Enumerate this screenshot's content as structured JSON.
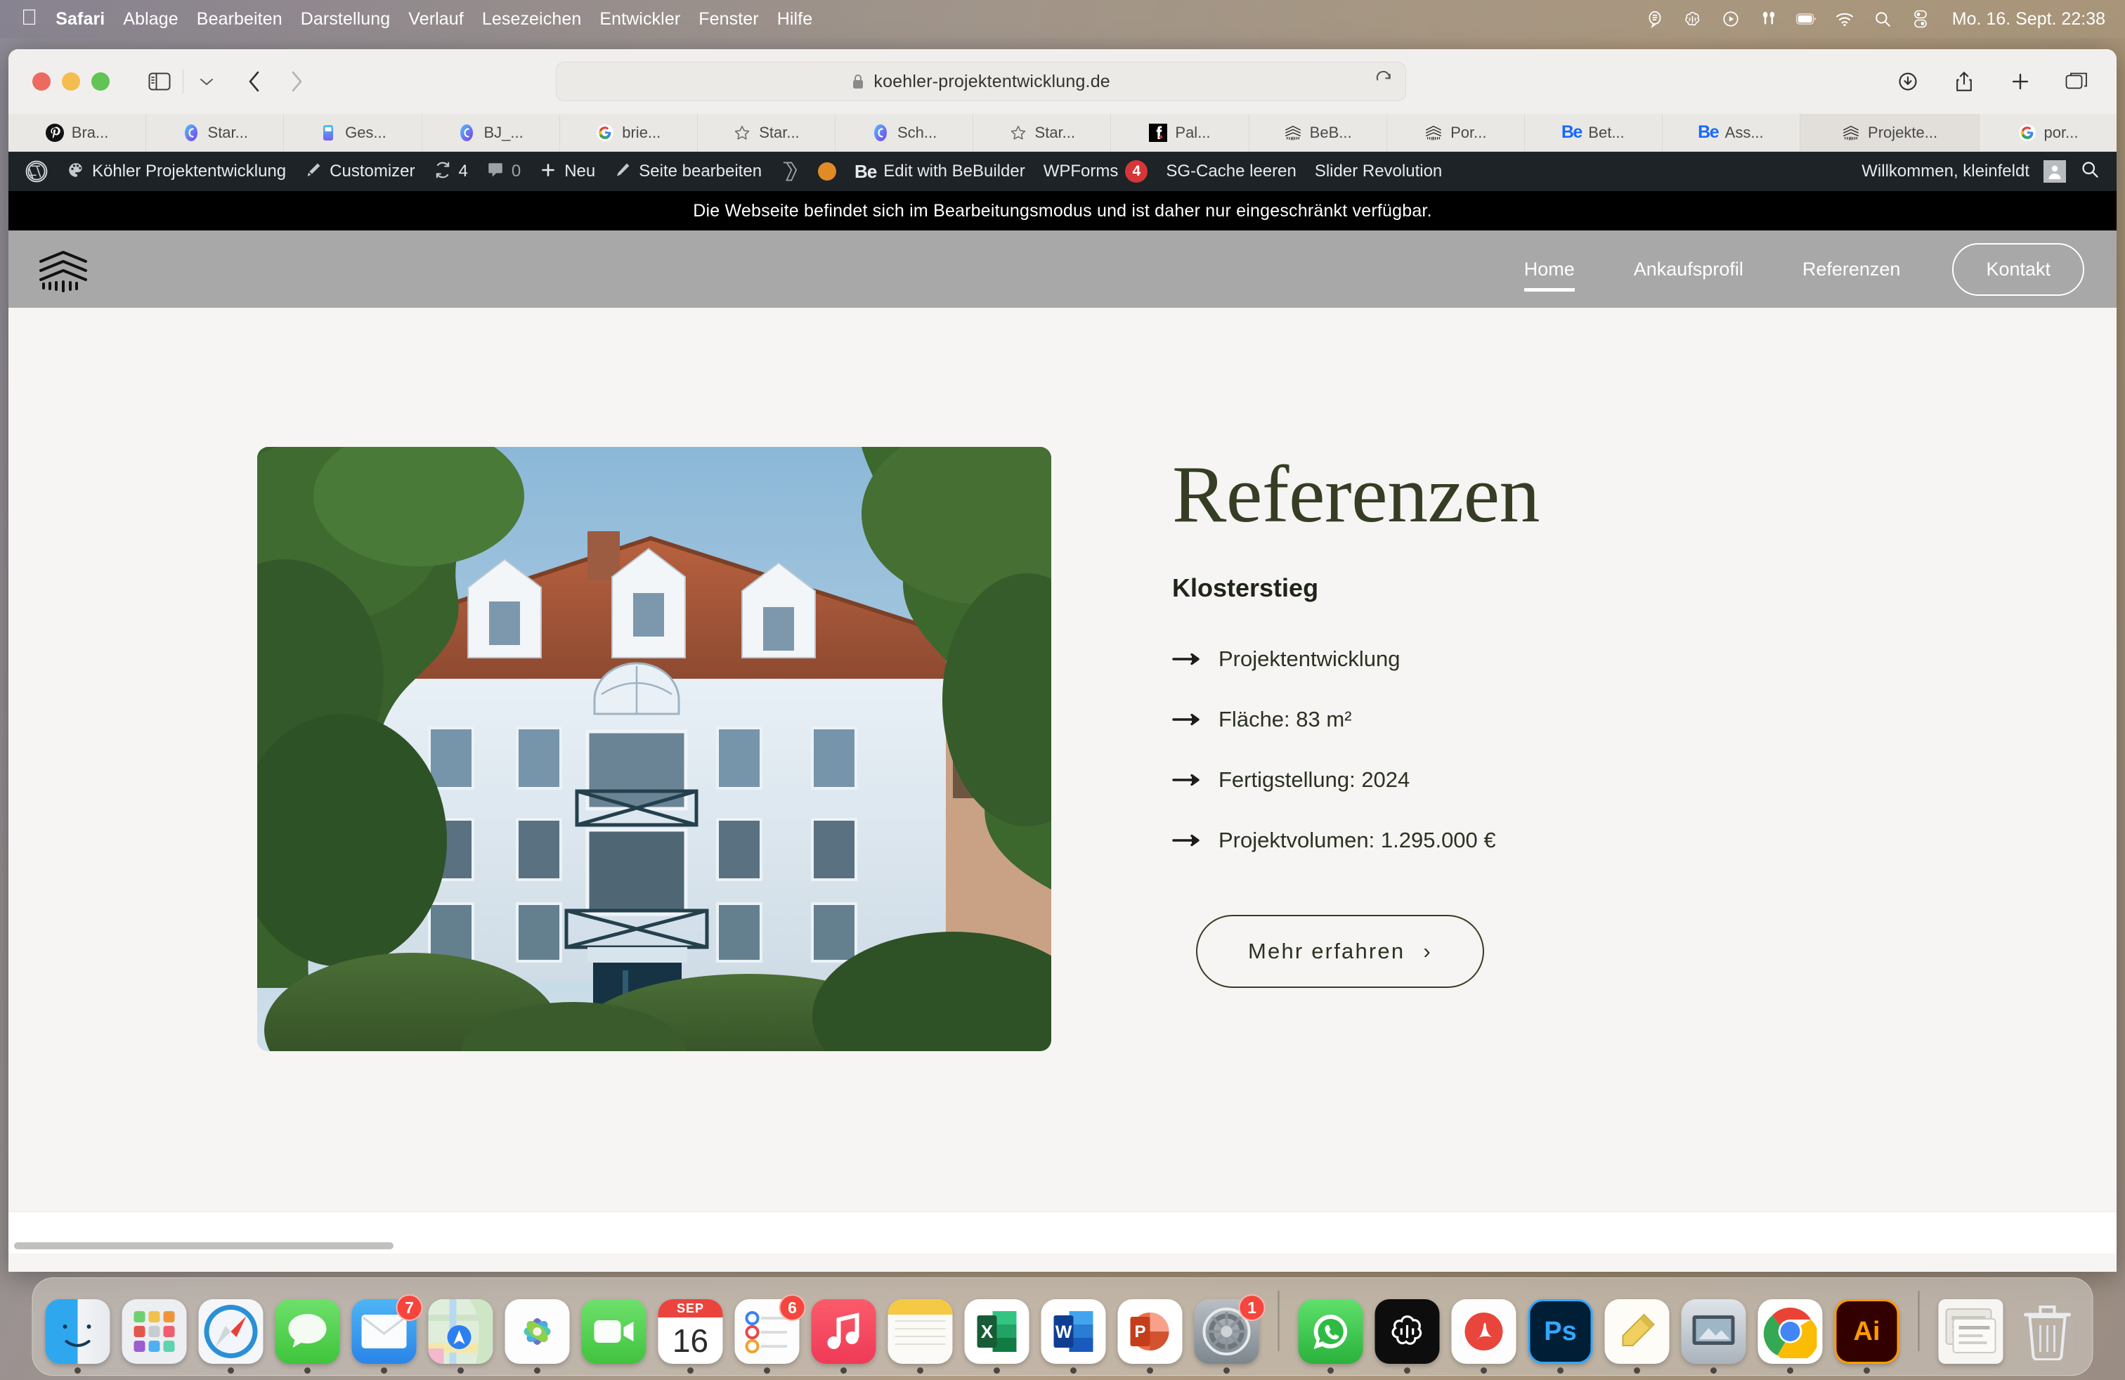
{
  "menubar": {
    "apple": "",
    "items": [
      {
        "label": "Safari",
        "bold": true
      },
      {
        "label": "Ablage",
        "bold": false
      },
      {
        "label": "Bearbeiten",
        "bold": false
      },
      {
        "label": "Darstellung",
        "bold": false
      },
      {
        "label": "Verlauf",
        "bold": false
      },
      {
        "label": "Lesezeichen",
        "bold": false
      },
      {
        "label": "Entwickler",
        "bold": false
      },
      {
        "label": "Fenster",
        "bold": false
      },
      {
        "label": "Hilfe",
        "bold": false
      }
    ],
    "status_icons": [
      "dictation-icon",
      "chatgpt-icon",
      "now-playing-icon",
      "airpods-icon",
      "battery-icon",
      "wifi-icon",
      "spotlight-search-icon",
      "control-center-icon"
    ],
    "clock": "Mo. 16. Sept.  22:38"
  },
  "safari": {
    "window_controls": [
      "close-button",
      "minimize-button",
      "zoom-button"
    ],
    "sidebar_button": "sidebar-icon",
    "back_button": "chevron-left-icon",
    "forward_button": "chevron-right-icon",
    "address": {
      "url": "koehler-projektentwicklung.de",
      "lock": "lock-icon",
      "reload": "reload-icon"
    },
    "right_buttons": [
      "downloads-icon",
      "share-icon",
      "new-tab-icon",
      "tab-overview-icon"
    ],
    "bookmarks": [
      {
        "label": "Bra...",
        "icon": "pinterest-icon"
      },
      {
        "label": "Star...",
        "icon": "chatgpt-circle-icon"
      },
      {
        "label": "Ges...",
        "icon": "app-icon"
      },
      {
        "label": "BJ_...",
        "icon": "chatgpt-circle-icon"
      },
      {
        "label": "brie...",
        "icon": "google-icon"
      },
      {
        "label": "Star...",
        "icon": "star-icon"
      },
      {
        "label": "Sch...",
        "icon": "chatgpt-circle-icon"
      },
      {
        "label": "Star...",
        "icon": "star-icon"
      },
      {
        "label": "Pal...",
        "icon": "facebook-icon"
      },
      {
        "label": "BeB...",
        "icon": "koehler-roof-icon"
      },
      {
        "label": "Por...",
        "icon": "koehler-roof-icon"
      },
      {
        "label": "Bet...",
        "icon": "behance-be-icon"
      },
      {
        "label": "Ass...",
        "icon": "behance-be-icon"
      },
      {
        "label": "Projekte...",
        "icon": "koehler-roof-icon",
        "active": true
      },
      {
        "label": "por...",
        "icon": "google-icon"
      }
    ]
  },
  "wp_admin_bar": {
    "logo": "wordpress-icon",
    "site_name": "Köhler Projektentwicklung",
    "site_icon": "dashboard-icon",
    "customizer": "Customizer",
    "customizer_icon": "brush-icon",
    "updates_count": "4",
    "updates_icon": "updates-icon",
    "comments_count": "0",
    "comments_icon": "comment-icon",
    "new": "Neu",
    "new_icon": "plus-icon",
    "edit_page": "Seite bearbeiten",
    "edit_page_icon": "pencil-icon",
    "yoast_icon": "yoast-icon",
    "status_dot": "orange-status-dot",
    "bebuilder_logo": "Be",
    "bebuilder": "Edit with BeBuilder",
    "wpforms": "WPForms",
    "wpforms_count": "4",
    "sg_cache": "SG-Cache leeren",
    "slider_revolution": "Slider Revolution",
    "greeting": "Willkommen, kleinfeldt",
    "avatar": "avatar",
    "search_icon": "search-icon"
  },
  "maintenance_banner": "Die Webseite befindet sich im Bearbeitungsmodus und ist daher nur eingeschränkt verfügbar.",
  "site": {
    "logo": "koehler-roof-logo",
    "nav": [
      {
        "label": "Home",
        "current": true
      },
      {
        "label": "Ankaufsprofil",
        "current": false
      },
      {
        "label": "Referenzen",
        "current": false
      }
    ],
    "cta": "Kontakt"
  },
  "reference": {
    "photo_alt": "klostersteig-building-photo",
    "title": "Referenzen",
    "subtitle": "Klosterstieg",
    "facts": [
      "Projektentwicklung",
      "Fläche: 83 m²",
      "Fertigstellung: 2024",
      "Projektvolumen: 1.295.000 €"
    ],
    "button": "Mehr erfahren",
    "button_chevron": "›"
  },
  "colors": {
    "heading_green": "#353d24",
    "banner_black": "#000000",
    "header_gray": "#a8a8a8",
    "wp_bar": "#1d2327",
    "badge_red": "#d63638"
  },
  "dock": {
    "apps": [
      {
        "name": "finder",
        "badge": "",
        "running": true
      },
      {
        "name": "launchpad",
        "badge": "",
        "running": false
      },
      {
        "name": "safari",
        "badge": "",
        "running": true
      },
      {
        "name": "messages",
        "badge": "",
        "running": true
      },
      {
        "name": "mail",
        "badge": "7",
        "running": true
      },
      {
        "name": "maps",
        "badge": "",
        "running": true
      },
      {
        "name": "photos",
        "badge": "",
        "running": true
      },
      {
        "name": "facetime",
        "badge": "",
        "running": false
      },
      {
        "name": "calendar",
        "badge": "",
        "running": true,
        "day": "16",
        "month": "SEP"
      },
      {
        "name": "reminders",
        "badge": "6",
        "running": true
      },
      {
        "name": "music",
        "badge": "",
        "running": true
      },
      {
        "name": "notes",
        "badge": "",
        "running": true
      },
      {
        "name": "excel",
        "badge": "",
        "running": true,
        "letter": "X"
      },
      {
        "name": "word",
        "badge": "",
        "running": true,
        "letter": "W"
      },
      {
        "name": "powerpoint",
        "badge": "",
        "running": true,
        "letter": "P"
      },
      {
        "name": "system-settings",
        "badge": "1",
        "running": true
      },
      {
        "name": "whatsapp",
        "badge": "",
        "running": true
      },
      {
        "name": "chatgpt",
        "badge": "",
        "running": true
      },
      {
        "name": "acrobat",
        "badge": "",
        "running": true
      },
      {
        "name": "photoshop",
        "badge": "",
        "running": true,
        "letter": "Ps"
      },
      {
        "name": "notes-yellow",
        "badge": "",
        "running": true
      },
      {
        "name": "preview",
        "badge": "",
        "running": true
      },
      {
        "name": "chrome",
        "badge": "",
        "running": true
      },
      {
        "name": "illustrator",
        "badge": "",
        "running": true,
        "letter": "Ai"
      },
      {
        "name": "downloads-stack",
        "badge": "",
        "running": false
      },
      {
        "name": "trash",
        "badge": "",
        "running": false
      }
    ]
  }
}
